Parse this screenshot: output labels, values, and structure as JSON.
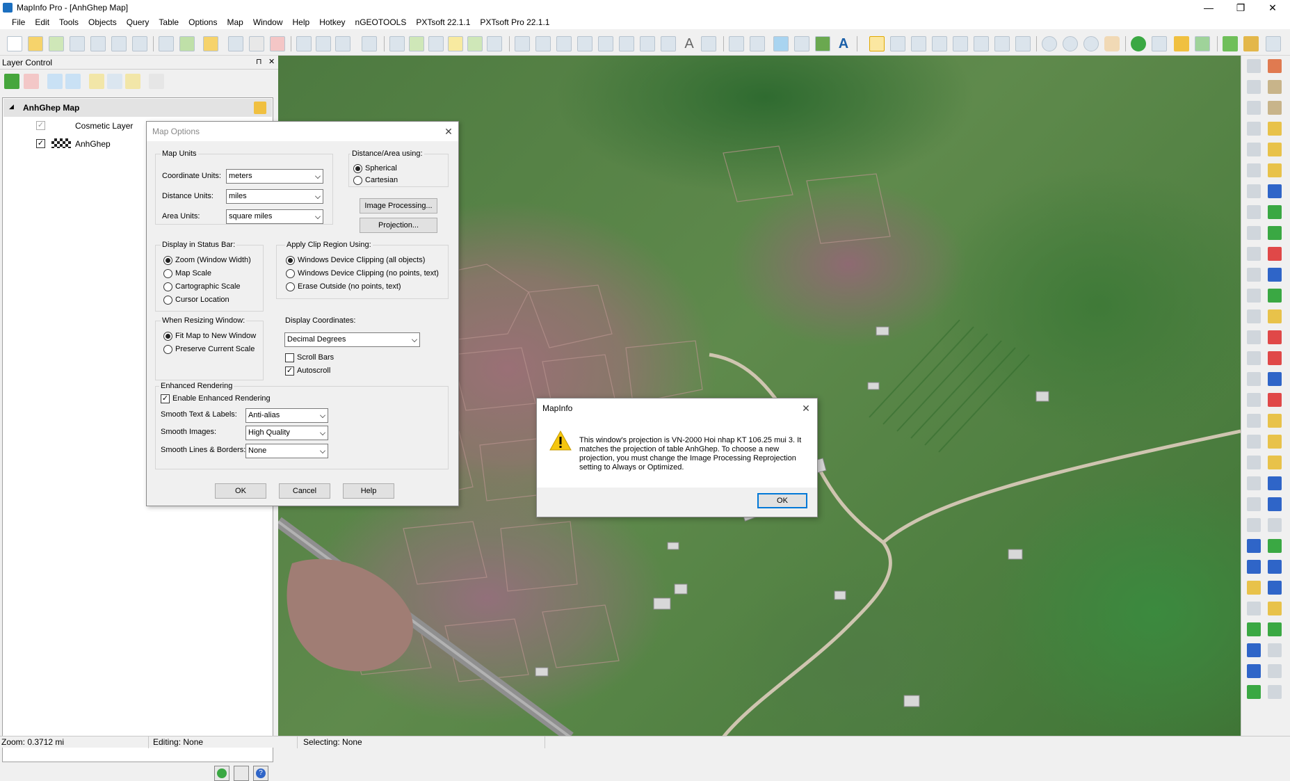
{
  "window": {
    "title": "MapInfo Pro - [AnhGhep Map]",
    "minimize": "—",
    "restore": "❐",
    "close": "✕"
  },
  "menu": [
    "File",
    "Edit",
    "Tools",
    "Objects",
    "Query",
    "Table",
    "Options",
    "Map",
    "Window",
    "Help",
    "Hotkey",
    "nGEOTOOLS",
    "PXTsoft 22.1.1",
    "PXTsoft Pro 22.1.1"
  ],
  "layer_control": {
    "title": "Layer Control",
    "pin": "⊓",
    "close": "✕",
    "map_name": "AnhGhep Map",
    "expand": "◢",
    "layers": [
      {
        "name": "Cosmetic Layer",
        "checked": "✓"
      },
      {
        "name": "AnhGhep",
        "checked": "✓"
      }
    ]
  },
  "map_options": {
    "title": "Map Options",
    "close": "✕",
    "map_units": {
      "label": "Map Units",
      "coordinate_label": "Coordinate Units:",
      "coordinate_value": "meters",
      "distance_label": "Distance Units:",
      "distance_value": "miles",
      "area_label": "Area Units:",
      "area_value": "square miles"
    },
    "distance_area": {
      "label": "Distance/Area using:",
      "spherical": "Spherical",
      "cartesian": "Cartesian"
    },
    "image_processing": "Image Processing...",
    "projection": "Projection...",
    "status_bar": {
      "label": "Display in Status Bar:",
      "zoom": "Zoom (Window Width)",
      "map_scale": "Map Scale",
      "cartographic": "Cartographic Scale",
      "cursor": "Cursor Location"
    },
    "clip_region": {
      "label": "Apply Clip Region Using:",
      "opt1": "Windows Device Clipping (all objects)",
      "opt2": "Windows Device Clipping (no points, text)",
      "opt3": "Erase Outside (no points, text)"
    },
    "resizing": {
      "label": "When Resizing Window:",
      "fit": "Fit Map to New Window",
      "preserve": "Preserve Current Scale"
    },
    "display_coords": {
      "label": "Display Coordinates:",
      "value": "Decimal Degrees",
      "scroll_bars": "Scroll Bars",
      "autoscroll": "Autoscroll",
      "check": "✓"
    },
    "rendering": {
      "label": "Enhanced Rendering",
      "enable": "Enable Enhanced Rendering",
      "smooth_text_label": "Smooth Text & Labels:",
      "smooth_text_value": "Anti-alias",
      "smooth_images_label": "Smooth Images:",
      "smooth_images_value": "High Quality",
      "smooth_lines_label": "Smooth Lines & Borders:",
      "smooth_lines_value": "None"
    },
    "ok": "OK",
    "cancel": "Cancel",
    "help": "Help"
  },
  "message": {
    "title": "MapInfo",
    "close": "✕",
    "text": "This window's projection is VN-2000 Hoi nhap KT 106.25 mui 3.  It matches the projection of table AnhGhep.  To choose a new projection, you must change the Image Processing Reprojection setting to Always or Optimized.",
    "ok": "OK"
  },
  "status": {
    "zoom": "Zoom: 0.3712 mi",
    "editing": "Editing: None",
    "selecting": "Selecting: None"
  }
}
